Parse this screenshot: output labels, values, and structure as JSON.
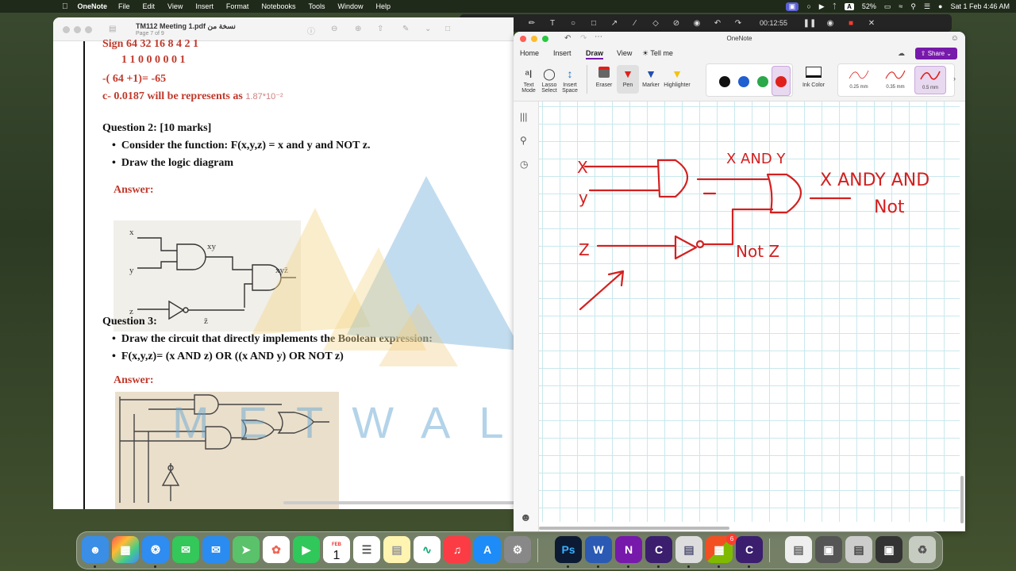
{
  "menubar": {
    "app_name": "OneNote",
    "items": [
      "File",
      "Edit",
      "View",
      "Insert",
      "Format",
      "Notebooks",
      "Tools",
      "Window",
      "Help"
    ],
    "battery": "52%",
    "input_badge": "A",
    "clock": "Sat 1 Feb  4:46 AM"
  },
  "recorder": {
    "timer": "00:12:55"
  },
  "pdf": {
    "title": "TM112 Meeting 1.pdf نسخة من",
    "subtitle": "Page 7 of 9",
    "lines": {
      "sign_row": "Sign 64 32 16 8 4 2 1",
      "bits_row": "1  1  0 0 0 0 0 1",
      "calc": "-( 64 +1)= -65",
      "c_item": "c- 0.0187 will be represents as",
      "c_value": "1.87*10⁻²",
      "q2_title": "Question 2: [10 marks]",
      "q2_b1": "Consider the function: F(x,y,z) = x and y and NOT z.",
      "q2_b2": "Draw the logic diagram",
      "answer1": "Answer:",
      "q3_title": "Question 3:",
      "q3_b1": "Draw the circuit that directly implements the Boolean expression:",
      "q3_b2": "F(x,y,z)= (x AND z) OR ((x AND y) OR NOT z)",
      "answer2": "Answer:"
    },
    "figure1_labels": {
      "x": "x",
      "y": "y",
      "z": "z",
      "xy": "xy",
      "xyz": "xyz̄",
      "zbar": "z̄"
    },
    "watermark": "METWAL"
  },
  "onenote": {
    "window_title": "OneNote",
    "tabs": [
      "Home",
      "Insert",
      "Draw",
      "View"
    ],
    "active_tab": "Draw",
    "tell_me": "Tell me",
    "share_label": "Share",
    "tools": {
      "text_mode": "Text Mode",
      "lasso": "Lasso Select",
      "insert_space": "Insert Space",
      "eraser": "Eraser",
      "pen": "Pen",
      "marker": "Marker",
      "highlighter": "Highlighter",
      "ink_color": "Ink Color"
    },
    "ink_colors": [
      "#111111",
      "#1f5fd1",
      "#2aa84a",
      "#e0201b"
    ],
    "pen_widths": [
      "0.25 mm",
      "0.35 mm",
      "0.5 mm"
    ],
    "handwriting": {
      "x": "X",
      "y": "y",
      "z": "Z",
      "x_and_y": "X AND Y",
      "result_1": "X ANDY AND",
      "result_2": "Not",
      "not_z": "Not Z"
    }
  },
  "dock": {
    "calendar_month": "FEB",
    "calendar_day": "1",
    "badge_count": "6"
  }
}
